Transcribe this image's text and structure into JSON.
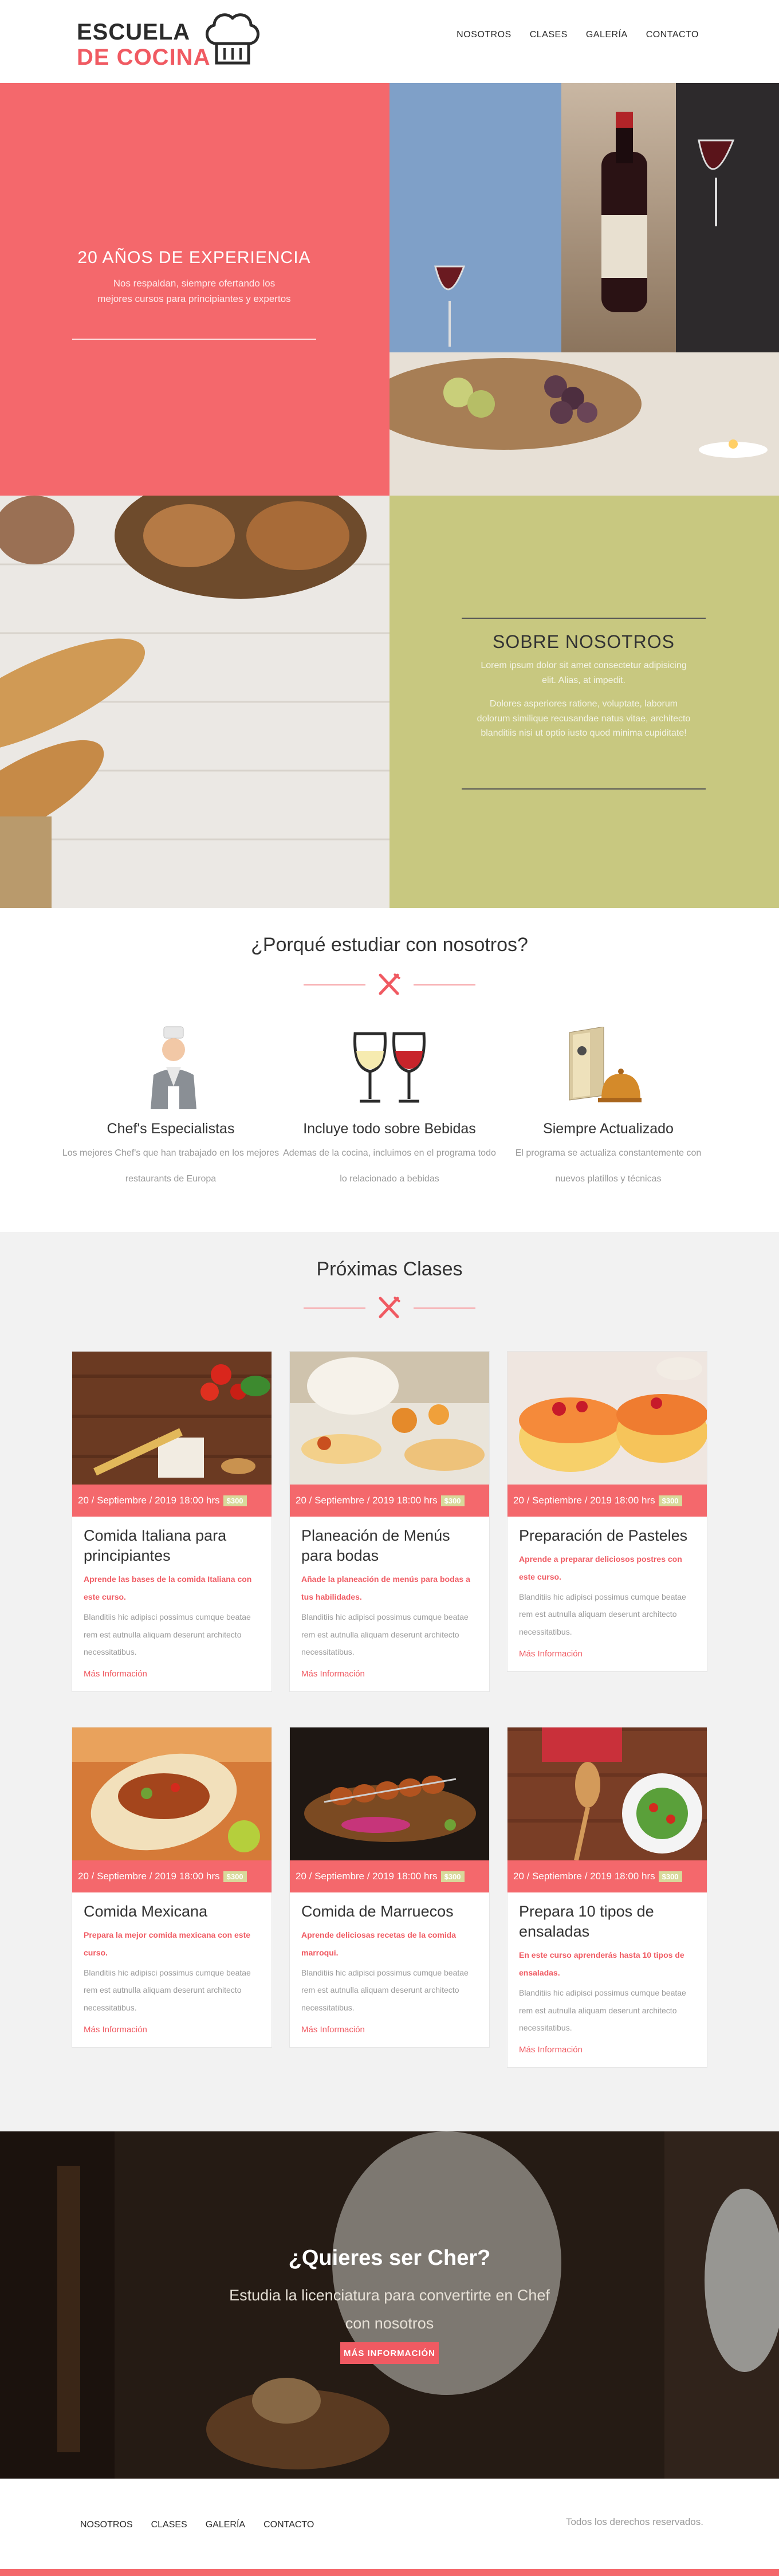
{
  "header": {
    "logo_line1": "ESCUELA",
    "logo_line2": "DE COCINA",
    "nav": [
      "NOSOTROS",
      "CLASES",
      "GALERÍA",
      "CONTACTO"
    ]
  },
  "hero": {
    "experience_title": "20 AÑOS DE EXPERIENCIA",
    "experience_text": "Nos respaldan, siempre ofertando los mejores cursos para principiantes y expertos",
    "about_title": "SOBRE NOSOTROS",
    "about_p1": "Lorem ipsum dolor sit amet consectetur adipisicing elit. Alias, at impedit.",
    "about_p2": "Dolores asperiores ratione, voluptate, laborum dolorum similique recusandae natus vitae, architecto blanditiis nisi ut optio iusto quod minima cupiditate!"
  },
  "why": {
    "title": "¿Porqué estudiar con nosotros?",
    "features": [
      {
        "title": "Chef's Especialistas",
        "text": "Los mejores Chef's que han trabajado en los mejores restaurants de Europa"
      },
      {
        "title": "Incluye todo sobre Bebidas",
        "text": "Ademas de la cocina, incluimos en el programa todo lo relacionado a bebidas"
      },
      {
        "title": "Siempre Actualizado",
        "text": "El programa se actualiza constantemente con nuevos platillos y técnicas"
      }
    ]
  },
  "classes": {
    "title": "Próximas Clases",
    "cards": [
      {
        "date": "20 / Septiembre / 2019 18:00 hrs",
        "price": "$300",
        "title": "Comida Italiana para principiantes",
        "lead": "Aprende las bases de la comida Italiana con este curso.",
        "text": "Blanditiis hic adipisci possimus cumque beatae rem est autnulla aliquam deserunt architecto necessitatibus.",
        "link": "Más Información"
      },
      {
        "date": "20 / Septiembre / 2019 18:00 hrs",
        "price": "$300",
        "title": "Planeación de Menús para bodas",
        "lead": "Añade la planeación de menús para bodas a tus habilidades.",
        "text": "Blanditiis hic adipisci possimus cumque beatae rem est autnulla aliquam deserunt architecto necessitatibus.",
        "link": "Más Información"
      },
      {
        "date": "20 / Septiembre / 2019 18:00 hrs",
        "price": "$300",
        "title": "Preparación de Pasteles",
        "lead": "Aprende a preparar deliciosos postres con este curso.",
        "text": "Blanditiis hic adipisci possimus cumque beatae rem est autnulla aliquam deserunt architecto necessitatibus.",
        "link": "Más Información"
      },
      {
        "date": "20 / Septiembre / 2019 18:00 hrs",
        "price": "$300",
        "title": "Comida Mexicana",
        "lead": "Prepara la mejor comida mexicana con este curso.",
        "text": "Blanditiis hic adipisci possimus cumque beatae rem est autnulla aliquam deserunt architecto necessitatibus.",
        "link": "Más Información"
      },
      {
        "date": "20 / Septiembre / 2019 18:00 hrs",
        "price": "$300",
        "title": "Comida de Marruecos",
        "lead": "Aprende deliciosas recetas de la comida marroquí.",
        "text": "Blanditiis hic adipisci possimus cumque beatae rem est autnulla aliquam deserunt architecto necessitatibus.",
        "link": "Más Información"
      },
      {
        "date": "20 / Septiembre / 2019 18:00 hrs",
        "price": "$300",
        "title": "Prepara 10 tipos de ensaladas",
        "lead": "En este curso aprenderás hasta 10 tipos de ensaladas.",
        "text": "Blanditiis hic adipisci possimus cumque beatae rem est autnulla aliquam deserunt architecto necessitatibus.",
        "link": "Más Información"
      }
    ]
  },
  "cta": {
    "title": "¿Quieres ser Cher?",
    "subtitle": "Estudia la licenciatura para convertirte en Chef con nosotros",
    "button": "MÁS INFORMACIÓN"
  },
  "footer": {
    "nav": [
      "NOSOTROS",
      "CLASES",
      "GALERÍA",
      "CONTACTO"
    ],
    "rights": "Todos los derechos reservados."
  },
  "colors": {
    "accent": "#f4686c",
    "olive": "#c8c880",
    "price_badge": "#d8d99a"
  }
}
